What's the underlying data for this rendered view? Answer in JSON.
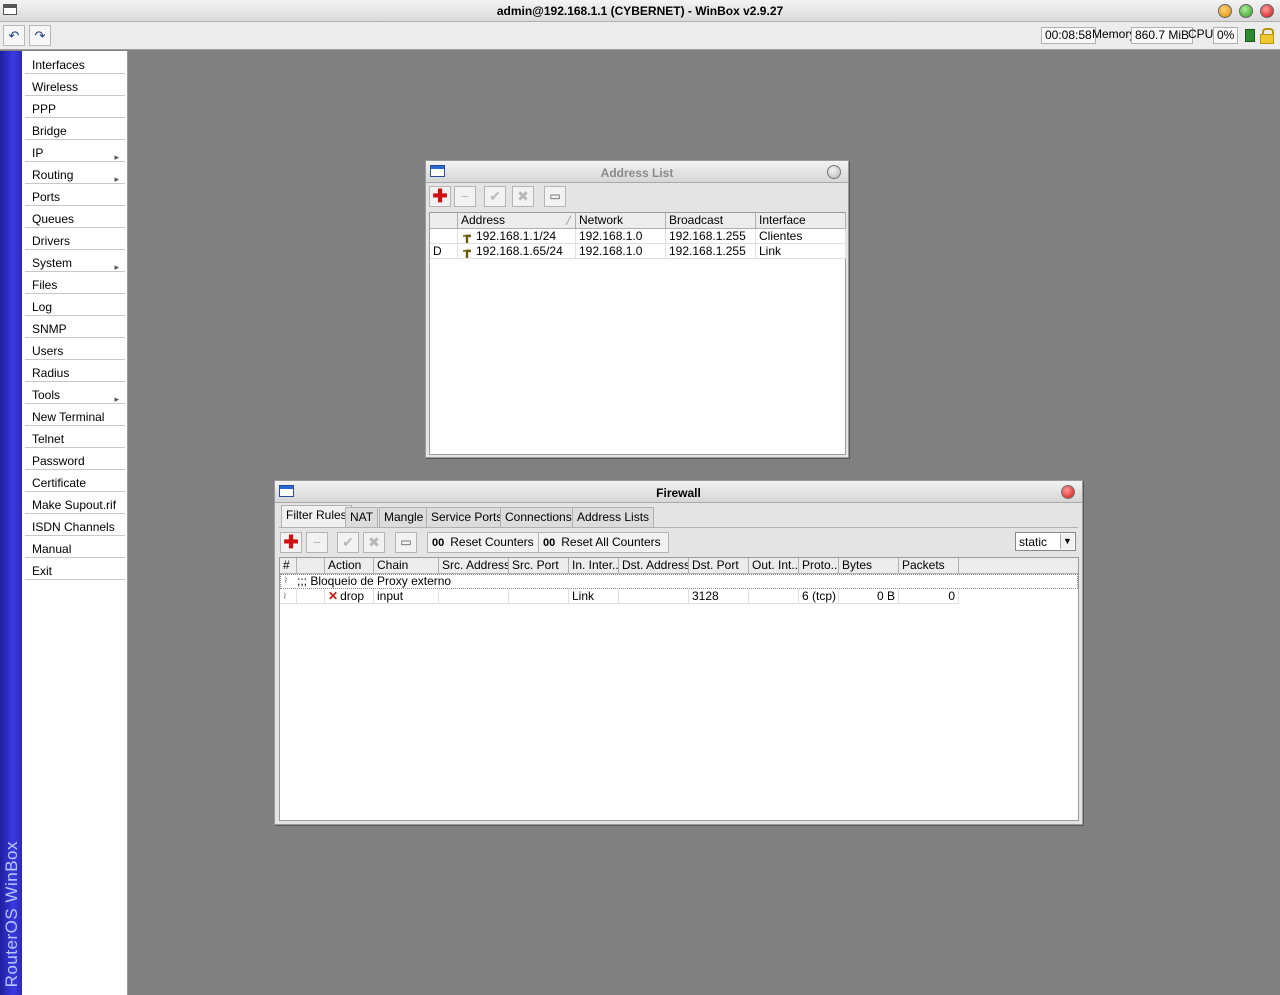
{
  "window": {
    "title": "admin@192.168.1.1 (CYBERNET) - WinBox v2.9.27"
  },
  "toolbar": {
    "undo_icon": "undo-icon",
    "redo_icon": "redo-icon",
    "uptime": "00:08:58",
    "memory_label": "Memory:",
    "memory_value": "860.7 MiB",
    "cpu_label": "CPU:",
    "cpu_value": "0%"
  },
  "brand": "RouterOS WinBox",
  "menu": {
    "items": [
      {
        "label": "Interfaces",
        "submenu": false
      },
      {
        "label": "Wireless",
        "submenu": false
      },
      {
        "label": "PPP",
        "submenu": false
      },
      {
        "label": "Bridge",
        "submenu": false
      },
      {
        "label": "IP",
        "submenu": true
      },
      {
        "label": "Routing",
        "submenu": true
      },
      {
        "label": "Ports",
        "submenu": false
      },
      {
        "label": "Queues",
        "submenu": false
      },
      {
        "label": "Drivers",
        "submenu": false
      },
      {
        "label": "System",
        "submenu": true
      },
      {
        "label": "Files",
        "submenu": false
      },
      {
        "label": "Log",
        "submenu": false
      },
      {
        "label": "SNMP",
        "submenu": false
      },
      {
        "label": "Users",
        "submenu": false
      },
      {
        "label": "Radius",
        "submenu": false
      },
      {
        "label": "Tools",
        "submenu": true
      },
      {
        "label": "New Terminal",
        "submenu": false
      },
      {
        "label": "Telnet",
        "submenu": false
      },
      {
        "label": "Password",
        "submenu": false
      },
      {
        "label": "Certificate",
        "submenu": false
      },
      {
        "label": "Make Supout.rif",
        "submenu": false
      },
      {
        "label": "ISDN Channels",
        "submenu": false
      },
      {
        "label": "Manual",
        "submenu": false
      },
      {
        "label": "Exit",
        "submenu": false
      }
    ]
  },
  "address_list": {
    "title": "Address List",
    "columns": [
      "Address",
      "Network",
      "Broadcast",
      "Interface"
    ],
    "rows": [
      {
        "flag": "",
        "address": "192.168.1.1/24",
        "network": "192.168.1.0",
        "broadcast": "192.168.1.255",
        "interface": "Clientes"
      },
      {
        "flag": "D",
        "address": "192.168.1.65/24",
        "network": "192.168.1.0",
        "broadcast": "192.168.1.255",
        "interface": "Link"
      }
    ]
  },
  "firewall": {
    "title": "Firewall",
    "tabs": [
      "Filter Rules",
      "NAT",
      "Mangle",
      "Service Ports",
      "Connections",
      "Address Lists"
    ],
    "reset_counters": "Reset Counters",
    "reset_all_counters": "Reset All Counters",
    "counter_glyph": "00",
    "filter_value": "static",
    "columns": [
      "#",
      "Action",
      "Chain",
      "Src. Address",
      "Src. Port",
      "In. Inter...",
      "Dst. Address",
      "Dst. Port",
      "Out. Int...",
      "Proto...",
      "Bytes",
      "Packets"
    ],
    "comment": ";;; Bloqueio de Proxy externo",
    "rule": {
      "action": "drop",
      "chain": "input",
      "src_address": "",
      "src_port": "",
      "in_interface": "Link",
      "dst_address": "",
      "dst_port": "3128",
      "out_interface": "",
      "protocol": "6 (tcp)",
      "bytes": "0 B",
      "packets": "0"
    }
  }
}
